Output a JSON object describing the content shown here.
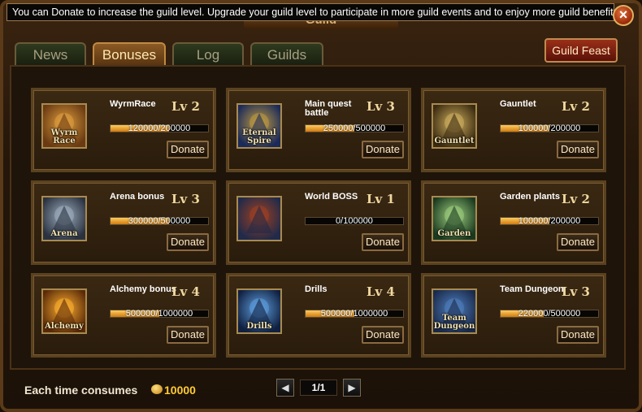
{
  "window": {
    "title": "Guild",
    "tooltip": "You can Donate to increase the guild level. Upgrade your guild level to participate in more guild events and to enjoy more guild benefits."
  },
  "tabs": [
    {
      "label": "News",
      "active": false
    },
    {
      "label": "Bonuses",
      "active": true
    },
    {
      "label": "Log",
      "active": false
    },
    {
      "label": "Guilds",
      "active": false
    }
  ],
  "guild_feast_label": "Guild Feast",
  "close_label": "×",
  "donate_label": "Donate",
  "bonuses": [
    {
      "name": "WyrmRace",
      "level": "Lv 2",
      "progress_text": "120000/200000",
      "progress": 0.6,
      "icon": "wyrm-race-icon",
      "icon_label": "Wyrm Race"
    },
    {
      "name": "Main quest battle",
      "level": "Lv 3",
      "progress_text": "250000/500000",
      "progress": 0.5,
      "icon": "eternal-spire-icon",
      "icon_label": "Eternal Spire"
    },
    {
      "name": "Gauntlet",
      "level": "Lv 2",
      "progress_text": "100000/200000",
      "progress": 0.5,
      "icon": "gauntlet-icon",
      "icon_label": "Gauntlet"
    },
    {
      "name": "Arena bonus",
      "level": "Lv 3",
      "progress_text": "300000/500000",
      "progress": 0.6,
      "icon": "arena-icon",
      "icon_label": "Arena"
    },
    {
      "name": "World BOSS",
      "level": "Lv 1",
      "progress_text": "0/100000",
      "progress": 0.0,
      "icon": "world-boss-icon",
      "icon_label": ""
    },
    {
      "name": "Garden plants",
      "level": "Lv 2",
      "progress_text": "100000/200000",
      "progress": 0.5,
      "icon": "garden-icon",
      "icon_label": "Garden"
    },
    {
      "name": "Alchemy bonus",
      "level": "Lv 4",
      "progress_text": "500000/1000000",
      "progress": 0.5,
      "icon": "alchemy-icon",
      "icon_label": "Alchemy"
    },
    {
      "name": "Drills",
      "level": "Lv 4",
      "progress_text": "500000/1000000",
      "progress": 0.5,
      "icon": "drills-icon",
      "icon_label": "Drills"
    },
    {
      "name": "Team Dungeon",
      "level": "Lv 3",
      "progress_text": "220000/500000",
      "progress": 0.44,
      "icon": "team-dungeon-icon",
      "icon_label": "Team Dungeon"
    }
  ],
  "footer": {
    "consume_label": "Each time consumes",
    "cost": "10000",
    "page": "1/1",
    "prev_label": "◀",
    "next_label": "▶"
  },
  "colors": {
    "accent": "#ffcc33",
    "bar_fill": "#e8960f",
    "feast_button": "#9a3018"
  }
}
